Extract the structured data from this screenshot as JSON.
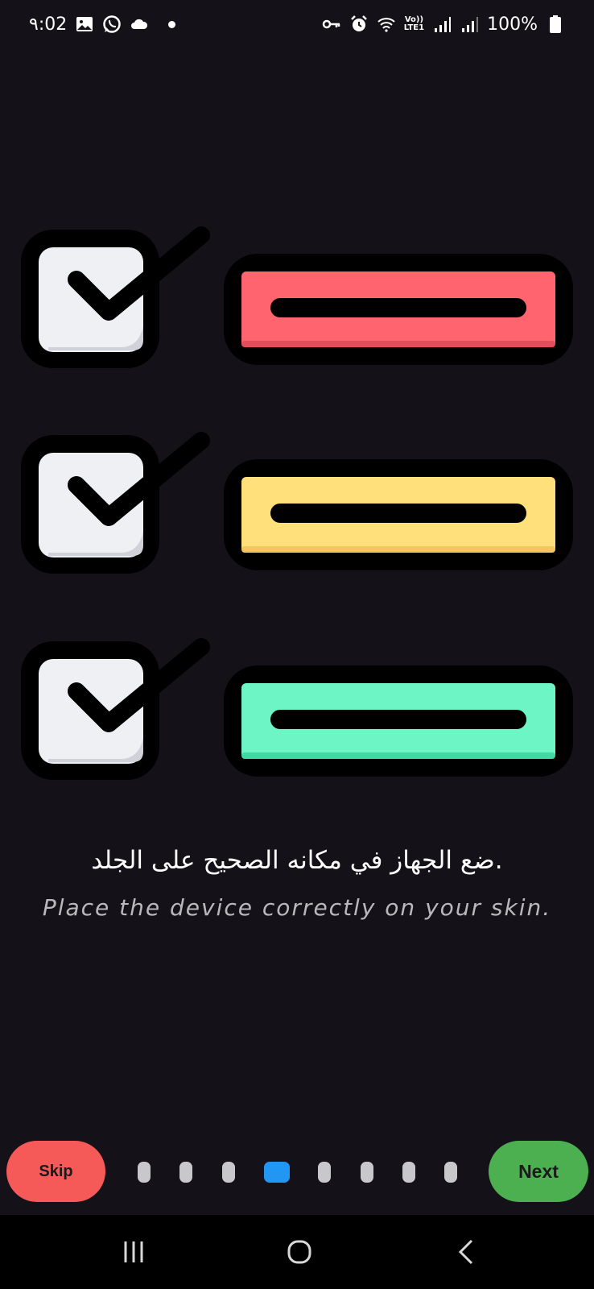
{
  "status_bar": {
    "time": "٩:02",
    "battery": "100%",
    "network_label_top": "Vo))",
    "network_label_bottom": "LTE1",
    "left_icons": [
      "gallery-icon",
      "whatsapp-icon",
      "cloud-icon",
      "notification-dot"
    ],
    "right_icons": [
      "vpn-key-icon",
      "alarm-icon",
      "wifi-icon",
      "signal-icon",
      "signal-icon",
      "battery-icon"
    ]
  },
  "illustration": {
    "rows": [
      {
        "bar_color": "#ff646f",
        "bar_shadow": "#e04f5a"
      },
      {
        "bar_color": "#ffe07a",
        "bar_shadow": "#f2c75b"
      },
      {
        "bar_color": "#6ef5c6",
        "bar_shadow": "#3fd9a2"
      }
    ],
    "checkbox_color": "#eef0f4"
  },
  "caption": {
    "arabic": ".ضع الجهاز في مكانه الصحيح على الجلد",
    "english": "Place the device correctly on your skin."
  },
  "controls": {
    "skip_label": "Skip",
    "next_label": "Next",
    "page_count": 8,
    "active_page": 4,
    "skip_color": "#f55a59",
    "next_color": "#4caf50",
    "active_dot_color": "#2196f3"
  },
  "nav_bar": {
    "items": [
      "recent-apps-icon",
      "home-icon",
      "back-icon"
    ]
  }
}
